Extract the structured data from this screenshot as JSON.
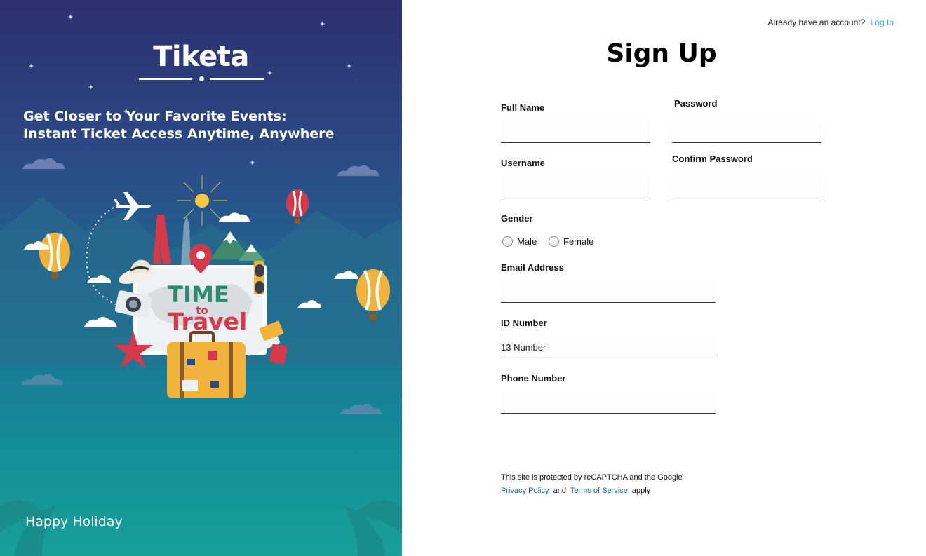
{
  "brand": {
    "name": "Tiketa"
  },
  "hero": {
    "tagline_line1": "Get Closer to Your Favorite Events:",
    "tagline_line2": "Instant Ticket Access Anytime, Anywhere",
    "poster_line1": "TIME",
    "poster_line2": "to",
    "poster_line3": "Travel",
    "footer": "Happy Holiday"
  },
  "header": {
    "prompt": "Already have an account?",
    "login_link": "Log In"
  },
  "form": {
    "title": "Sign Up",
    "full_name": {
      "label": "Full Name",
      "value": "",
      "placeholder": ""
    },
    "password": {
      "label": "Password",
      "value": "",
      "placeholder": ""
    },
    "username": {
      "label": "Username",
      "value": "",
      "placeholder": ""
    },
    "confirm_password": {
      "label": "Confirm Password",
      "value": "",
      "placeholder": ""
    },
    "gender": {
      "label": "Gender",
      "options": [
        "Male",
        "Female"
      ],
      "selected": null
    },
    "email": {
      "label": "Email Address",
      "value": "",
      "placeholder": ""
    },
    "id_number": {
      "label": "ID Number",
      "value": "",
      "placeholder": "13 Number"
    },
    "phone": {
      "label": "Phone Number",
      "value": "",
      "placeholder": ""
    }
  },
  "legal": {
    "line1": "This site is protected by reCAPTCHA and the Google",
    "privacy_link": "Privacy Policy",
    "and": "and",
    "terms_link": "Terms of Service",
    "apply": "apply"
  },
  "colors": {
    "panel_top": "#2d2f6e",
    "panel_bottom": "#18a09a",
    "link": "#1ab0d8",
    "legal_link": "#1a5fb4",
    "poster_green": "#2e8b6a",
    "poster_red": "#d63a4a",
    "suitcase": "#f2b33d"
  },
  "icons": [
    "plane-icon",
    "hot-air-balloon-icon",
    "map-pin-icon",
    "suitcase-icon",
    "starfish-icon",
    "camera-icon",
    "sunglasses-icon",
    "ticket-icon",
    "eiffel-tower-icon",
    "palm-leaf-icon",
    "cloud-icon"
  ]
}
